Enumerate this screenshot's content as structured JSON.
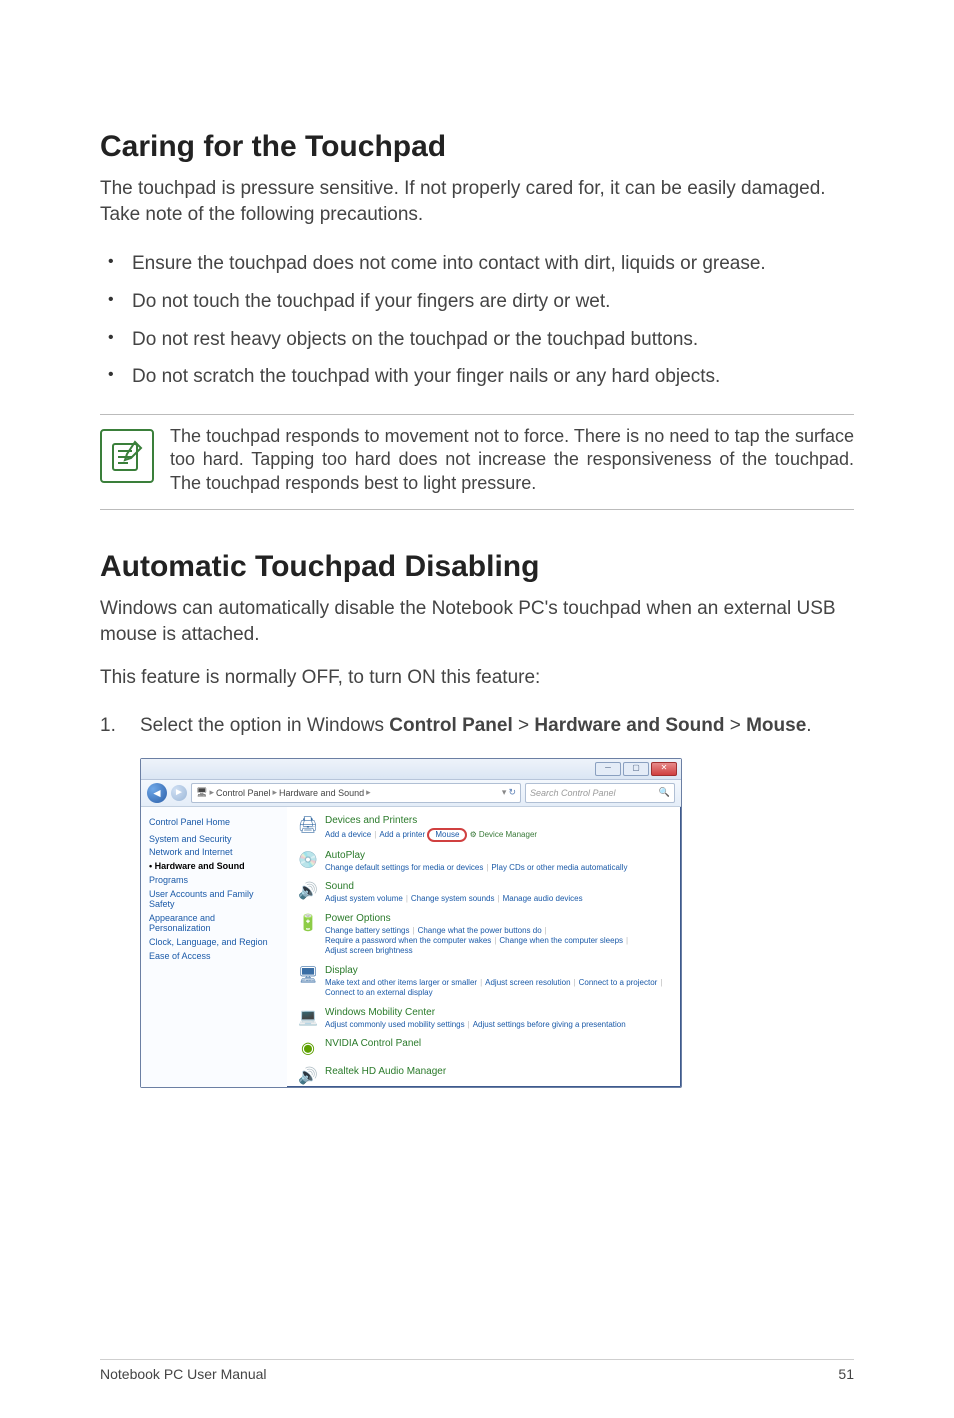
{
  "sections": {
    "caring": {
      "heading": "Caring for the Touchpad",
      "intro": "The touchpad is pressure sensitive. If not properly cared for, it can be easily damaged. Take note of the following precautions.",
      "bullets": [
        "Ensure the touchpad does not come into contact with dirt, liquids or grease.",
        "Do not touch the touchpad if your fingers are dirty or wet.",
        "Do not rest heavy objects on the touchpad or the touchpad buttons.",
        "Do not scratch the touchpad with your finger nails or any hard objects."
      ],
      "note": "The touchpad responds to movement not to force. There is no need to tap the surface too hard. Tapping too hard does not increase the responsiveness of the touchpad. The touchpad responds best to light pressure."
    },
    "auto_disable": {
      "heading": "Automatic Touchpad Disabling",
      "para1": "Windows can automatically disable the Notebook PC's touchpad when an external USB mouse is attached.",
      "para2": "This feature is normally OFF, to turn ON this feature:",
      "step1_num": "1.",
      "step1_prefix": "Select the option in Windows ",
      "step1_b1": "Control Panel",
      "step1_sep1": " > ",
      "step1_b2": "Hardware and Sound",
      "step1_sep2": " > ",
      "step1_b3": "Mouse",
      "step1_suffix": "."
    }
  },
  "screenshot": {
    "breadcrumb": {
      "icon_label": "Control Panel",
      "path1": "Control Panel",
      "path2": "Hardware and Sound"
    },
    "search_placeholder": "Search Control Panel",
    "refresh_label": "↻",
    "sidebar": {
      "home": "Control Panel Home",
      "items": [
        {
          "label": "System and Security",
          "active": false
        },
        {
          "label": "Network and Internet",
          "active": false
        },
        {
          "label": "Hardware and Sound",
          "active": true
        },
        {
          "label": "Programs",
          "active": false
        },
        {
          "label": "User Accounts and Family Safety",
          "active": false
        },
        {
          "label": "Appearance and Personalization",
          "active": false
        },
        {
          "label": "Clock, Language, and Region",
          "active": false
        },
        {
          "label": "Ease of Access",
          "active": false
        }
      ]
    },
    "categories": {
      "devices": {
        "title": "Devices and Printers",
        "link1": "Add a device",
        "link2": "Add a printer",
        "mouse": "Mouse",
        "device_mgr": "Device Manager"
      },
      "autoplay": {
        "title": "AutoPlay",
        "link1": "Change default settings for media or devices",
        "link2": "Play CDs or other media automatically"
      },
      "sound": {
        "title": "Sound",
        "link1": "Adjust system volume",
        "link2": "Change system sounds",
        "link3": "Manage audio devices"
      },
      "power": {
        "title": "Power Options",
        "link1": "Change battery settings",
        "link2": "Change what the power buttons do",
        "link3": "Require a password when the computer wakes",
        "link4": "Change when the computer sleeps",
        "link5": "Adjust screen brightness"
      },
      "display": {
        "title": "Display",
        "link1": "Make text and other items larger or smaller",
        "link2": "Adjust screen resolution",
        "link3": "Connect to a projector",
        "link4": "Connect to an external display"
      },
      "mobility": {
        "title": "Windows Mobility Center",
        "link1": "Adjust commonly used mobility settings",
        "link2": "Adjust settings before giving a presentation"
      },
      "nvidia": {
        "title": "NVIDIA Control Panel"
      },
      "realtek": {
        "title": "Realtek HD Audio Manager"
      }
    }
  },
  "footer": {
    "left": "Notebook PC User Manual",
    "right": "51"
  }
}
